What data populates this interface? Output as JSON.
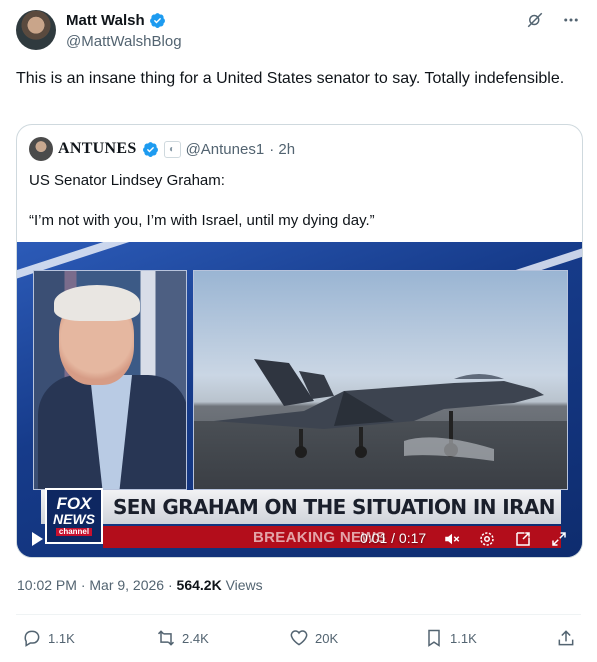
{
  "author": {
    "name": "Matt Walsh",
    "handle": "@MattWalshBlog"
  },
  "tweet": {
    "text": "This is an insane thing for a United States senator to say. Totally indefensible.",
    "timestamp": "10:02 PM · Mar 9, 2026 · ",
    "views_count": "564.2K",
    "views_label": " Views"
  },
  "quote": {
    "name": "ANTUNES",
    "handle": "@Antunes1",
    "time": "· 2h",
    "text": "US Senator Lindsey Graham:\n\n“I’m not with you, I’m with Israel, until my dying day.”",
    "video": {
      "chyron": "SEN GRAHAM ON THE SITUATION IN IRAN",
      "logo_line1": "FOX",
      "logo_line2": "NEWS",
      "logo_line3": "channel",
      "breaking": "BREAKING NEWS",
      "timecode": "0:01 / 0:17"
    }
  },
  "actions": {
    "replies": "1.1K",
    "reposts": "2.4K",
    "likes": "20K",
    "bookmarks": "1.1K"
  },
  "colors": {
    "verified": "#1d9bf0",
    "secondary_text": "#536471",
    "border": "#cfd9de"
  },
  "icons": [
    "verified-badge-icon",
    "grok-icon",
    "more-icon",
    "play-icon",
    "mute-icon",
    "settings-icon",
    "pip-icon",
    "fullscreen-icon",
    "reply-icon",
    "repost-icon",
    "like-icon",
    "bookmark-icon",
    "share-icon"
  ]
}
